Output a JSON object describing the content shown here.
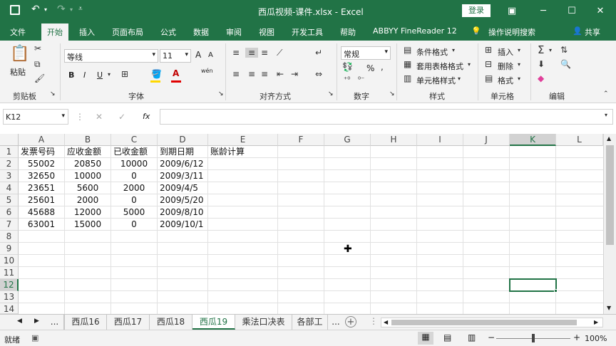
{
  "titlebar": {
    "filename": "西瓜视频-课件.xlsx",
    "sep": "-",
    "app": "Excel",
    "login": "登录",
    "save_icon": "save-icon",
    "undo_icon": "undo-icon",
    "redo_icon": "redo-icon"
  },
  "tabs": [
    "文件",
    "开始",
    "插入",
    "页面布局",
    "公式",
    "数据",
    "审阅",
    "视图",
    "开发工具",
    "帮助",
    "ABBYY FineReader 12"
  ],
  "active_tab": "开始",
  "tell_me": "操作说明搜索",
  "share": "共享",
  "ribbon": {
    "clipboard": {
      "paste": "粘贴",
      "label": "剪贴板"
    },
    "font": {
      "name": "等线",
      "size": "11",
      "label": "字体",
      "bold": "B",
      "italic": "I",
      "underline": "U",
      "wen": "wén",
      "grow": "A",
      "shrink": "A"
    },
    "align": {
      "label": "对齐方式"
    },
    "number": {
      "format": "常规",
      "label": "数字",
      "pct": "%"
    },
    "styles": {
      "cond": "条件格式",
      "table": "套用表格格式",
      "cell": "单元格样式",
      "label": "样式"
    },
    "cells": {
      "insert": "插入",
      "delete": "删除",
      "format": "格式",
      "label": "单元格"
    },
    "editing": {
      "label": "编辑"
    }
  },
  "formula_bar": {
    "namebox": "K12",
    "fx": "fx",
    "value": ""
  },
  "columns": [
    "A",
    "B",
    "C",
    "D",
    "E",
    "F",
    "G",
    "H",
    "I",
    "J",
    "K",
    "L"
  ],
  "rows": [
    "1",
    "2",
    "3",
    "4",
    "5",
    "6",
    "7",
    "8",
    "9",
    "10",
    "11",
    "12",
    "13",
    "14"
  ],
  "table": {
    "headers": [
      "发票号码",
      "应收金额",
      "已收金额",
      "到期日期",
      "账龄计算"
    ],
    "data": [
      [
        "55002",
        "20850",
        "10000",
        "2009/6/12"
      ],
      [
        "32650",
        "10000",
        "0",
        "2009/3/11"
      ],
      [
        "23651",
        "5600",
        "2000",
        "2009/4/5"
      ],
      [
        "25601",
        "2000",
        "0",
        "2009/5/20"
      ],
      [
        "45688",
        "12000",
        "5000",
        "2009/8/10"
      ],
      [
        "63001",
        "15000",
        "0",
        "2009/10/1"
      ]
    ]
  },
  "sheets": [
    "西瓜16",
    "西瓜17",
    "西瓜18",
    "西瓜19",
    "乘法口决表",
    "各部工"
  ],
  "active_sheet": "西瓜19",
  "sheet_more": "...",
  "status": {
    "ready": "就绪",
    "zoom": "100%"
  }
}
